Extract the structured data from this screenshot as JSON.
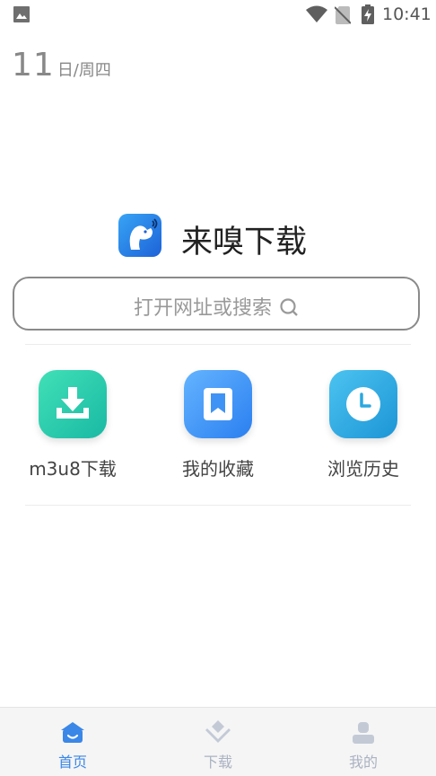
{
  "status_bar": {
    "time": "10:41",
    "icons": [
      "gallery-icon",
      "wifi-icon",
      "no-sim-icon",
      "battery-charging-icon"
    ]
  },
  "date": {
    "day": "11",
    "suffix": "日/周四"
  },
  "brand": {
    "name": "来嗅下载",
    "logo_icon": "dog-logo-icon"
  },
  "search": {
    "placeholder": "打开网址或搜索"
  },
  "quick_actions": [
    {
      "label": "m3u8下载",
      "icon": "download-tray-icon",
      "color": "#2cc9ad"
    },
    {
      "label": "我的收藏",
      "icon": "bookmark-icon",
      "color": "#3f93f5"
    },
    {
      "label": "浏览历史",
      "icon": "clock-icon",
      "color": "#2aa8e1"
    }
  ],
  "bottom_nav": {
    "items": [
      {
        "label": "首页",
        "icon": "home-icon",
        "active": true
      },
      {
        "label": "下载",
        "icon": "download-icon",
        "active": false
      },
      {
        "label": "我的",
        "icon": "user-icon",
        "active": false
      }
    ],
    "active_color": "#3a87e8",
    "inactive_color": "#aab2c2"
  }
}
